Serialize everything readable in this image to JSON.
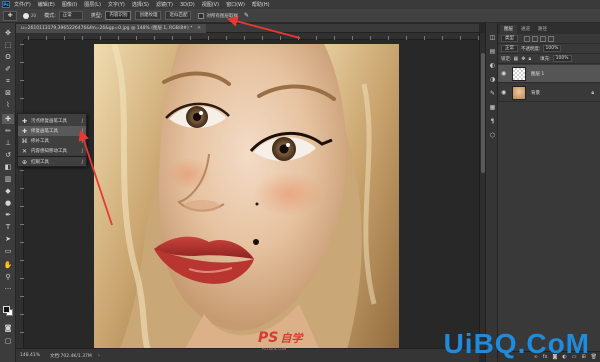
{
  "app": {
    "logo_text": "Ps"
  },
  "menubar": {
    "items": [
      "文件(F)",
      "编辑(E)",
      "图像(I)",
      "图层(L)",
      "文字(Y)",
      "选择(S)",
      "滤镜(T)",
      "3D(D)",
      "视图(V)",
      "窗口(W)",
      "帮助(H)"
    ]
  },
  "options": {
    "brush_size": "20",
    "mode_label": "模式:",
    "mode_value": "正常",
    "type_label": "类型:",
    "type_btn_1": "内容识别",
    "type_btn_2": "创建纹理",
    "type_btn_3": "近似匹配",
    "sample_all_label": "对所有图层取样"
  },
  "document": {
    "tab_title": "u=2610113179,3965226476&fm=26&gp=0.jpg @ 148% (图层 1, RGB/8#) *",
    "close_symbol": "×"
  },
  "flyout": {
    "items": [
      {
        "label": "污点修复画笔工具",
        "key": "J",
        "icon": "spot-heal-icon"
      },
      {
        "label": "修复画笔工具",
        "key": "J",
        "icon": "heal-brush-icon"
      },
      {
        "label": "修补工具",
        "key": "J",
        "icon": "patch-icon"
      },
      {
        "label": "内容感知移动工具",
        "key": "J",
        "icon": "content-move-icon"
      },
      {
        "label": "红眼工具",
        "key": "J",
        "icon": "red-eye-icon"
      }
    ]
  },
  "status": {
    "zoom": "148.41%",
    "doc": "文档:702.4K/1.37M",
    "arrow": "›"
  },
  "panel": {
    "tabs": [
      "图层",
      "通道",
      "路径"
    ],
    "filter_value": "类型",
    "blend_mode": "正常",
    "opacity_label": "不透明度:",
    "opacity_value": "100%",
    "lock_label": "锁定:",
    "fill_label": "填充:",
    "fill_value": "100%",
    "layers": [
      {
        "name": "图层 1",
        "thumb": "transparent",
        "selected": true
      },
      {
        "name": "背景",
        "thumb": "photo",
        "selected": false,
        "locked": true
      }
    ]
  },
  "watermark": {
    "ps": "PS",
    "site": "自学",
    "sub": "PSZIXUE.COM",
    "uibq": "UiBQ.CoM"
  },
  "colors": {
    "ui_bg": "#282828",
    "panel_bg": "#393939",
    "accent_red": "#e53935",
    "uibq_blue": "#1e8bdc"
  }
}
